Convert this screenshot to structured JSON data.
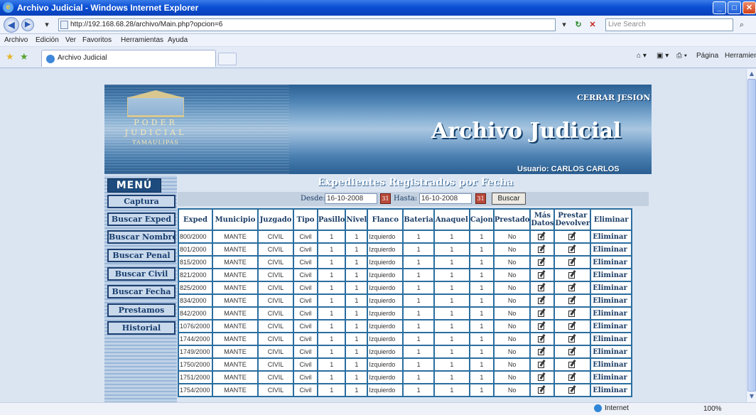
{
  "window": {
    "title": "Archivo Judicial - Windows Internet Explorer",
    "url": "http://192.168.68.28/archivo/Main.php?opcion=6",
    "search_placeholder": "Live Search",
    "tab_title": "Archivo Judicial",
    "tab_right_page": "Página",
    "tab_right_tools": "Herramientas",
    "menus": [
      "Archivo",
      "Edición",
      "Ver",
      "Favoritos",
      "Herramientas",
      "Ayuda"
    ],
    "status_zone": "Internet",
    "status_zoom": "100%"
  },
  "header": {
    "logo_lines": [
      "PODER",
      "JUDICIAL",
      "TAMAULIPAS"
    ],
    "logout_link": "CERRAR JESION",
    "app_title": "Archivo Judicial",
    "user_label": "Usuario: CARLOS CARLOS"
  },
  "sidebar": {
    "heading": "MENÚ",
    "items": [
      "Captura",
      "Buscar Exped",
      "Buscar Nombre",
      "Buscar Penal",
      "Buscar Civil",
      "Buscar Fecha",
      "Prestamos",
      "Historial"
    ]
  },
  "main": {
    "heading": "Expedientes Registrados por Fecha",
    "from_label": "Desde:",
    "from_value": "16-10-2008",
    "to_label": "Hasta:",
    "to_value": "16-10-2008",
    "search_button": "Buscar",
    "columns": [
      "Exped",
      "Municipio",
      "Juzgado",
      "Tipo",
      "Pasillo",
      "Nivel",
      "Flanco",
      "Bateria",
      "Anaquel",
      "Cajon",
      "Prestado",
      "Más Datos",
      "Prestar Devolver",
      "Eliminar"
    ],
    "delete_label": "Eliminar",
    "rows": [
      {
        "exped": "800/2000",
        "municipio": "MANTE",
        "juzgado": "CIVIL",
        "tipo": "Civil",
        "pasillo": "1",
        "nivel": "1",
        "flanco": "Izquierdo",
        "bateria": "1",
        "anaquel": "1",
        "cajon": "1",
        "prestado": "No"
      },
      {
        "exped": "801/2000",
        "municipio": "MANTE",
        "juzgado": "CIVIL",
        "tipo": "Civil",
        "pasillo": "1",
        "nivel": "1",
        "flanco": "Izquierdo",
        "bateria": "1",
        "anaquel": "1",
        "cajon": "1",
        "prestado": "No"
      },
      {
        "exped": "815/2000",
        "municipio": "MANTE",
        "juzgado": "CIVIL",
        "tipo": "Civil",
        "pasillo": "1",
        "nivel": "1",
        "flanco": "Izquierdo",
        "bateria": "1",
        "anaquel": "1",
        "cajon": "1",
        "prestado": "No"
      },
      {
        "exped": "821/2000",
        "municipio": "MANTE",
        "juzgado": "CIVIL",
        "tipo": "Civil",
        "pasillo": "1",
        "nivel": "1",
        "flanco": "Izquierdo",
        "bateria": "1",
        "anaquel": "1",
        "cajon": "1",
        "prestado": "No"
      },
      {
        "exped": "825/2000",
        "municipio": "MANTE",
        "juzgado": "CIVIL",
        "tipo": "Civil",
        "pasillo": "1",
        "nivel": "1",
        "flanco": "Izquierdo",
        "bateria": "1",
        "anaquel": "1",
        "cajon": "1",
        "prestado": "No"
      },
      {
        "exped": "834/2000",
        "municipio": "MANTE",
        "juzgado": "CIVIL",
        "tipo": "Civil",
        "pasillo": "1",
        "nivel": "1",
        "flanco": "Izquierdo",
        "bateria": "1",
        "anaquel": "1",
        "cajon": "1",
        "prestado": "No"
      },
      {
        "exped": "842/2000",
        "municipio": "MANTE",
        "juzgado": "CIVIL",
        "tipo": "Civil",
        "pasillo": "1",
        "nivel": "1",
        "flanco": "Izquierdo",
        "bateria": "1",
        "anaquel": "1",
        "cajon": "1",
        "prestado": "No"
      },
      {
        "exped": "1076/2000",
        "municipio": "MANTE",
        "juzgado": "CIVIL",
        "tipo": "Civil",
        "pasillo": "1",
        "nivel": "1",
        "flanco": "Izquierdo",
        "bateria": "1",
        "anaquel": "1",
        "cajon": "1",
        "prestado": "No"
      },
      {
        "exped": "1744/2000",
        "municipio": "MANTE",
        "juzgado": "CIVIL",
        "tipo": "Civil",
        "pasillo": "1",
        "nivel": "1",
        "flanco": "Izquierdo",
        "bateria": "1",
        "anaquel": "1",
        "cajon": "1",
        "prestado": "No"
      },
      {
        "exped": "1749/2000",
        "municipio": "MANTE",
        "juzgado": "CIVIL",
        "tipo": "Civil",
        "pasillo": "1",
        "nivel": "1",
        "flanco": "Izquierdo",
        "bateria": "1",
        "anaquel": "1",
        "cajon": "1",
        "prestado": "No"
      },
      {
        "exped": "1750/2000",
        "municipio": "MANTE",
        "juzgado": "CIVIL",
        "tipo": "Civil",
        "pasillo": "1",
        "nivel": "1",
        "flanco": "Izquierdo",
        "bateria": "1",
        "anaquel": "1",
        "cajon": "1",
        "prestado": "No"
      },
      {
        "exped": "1751/2000",
        "municipio": "MANTE",
        "juzgado": "CIVIL",
        "tipo": "Civil",
        "pasillo": "1",
        "nivel": "1",
        "flanco": "Izquierdo",
        "bateria": "1",
        "anaquel": "1",
        "cajon": "1",
        "prestado": "No"
      },
      {
        "exped": "1754/2000",
        "municipio": "MANTE",
        "juzgado": "CIVIL",
        "tipo": "Civil",
        "pasillo": "1",
        "nivel": "1",
        "flanco": "Izquierdo",
        "bateria": "1",
        "anaquel": "1",
        "cajon": "1",
        "prestado": "No"
      }
    ]
  },
  "icons": {
    "more_data": "edit-icon",
    "lend_return": "edit-icon",
    "calendar": "calendar-icon"
  },
  "colors": {
    "brand_dark": "#1e4b7d",
    "table_border": "#2a6ea0",
    "header_text": "#1c3d66"
  }
}
